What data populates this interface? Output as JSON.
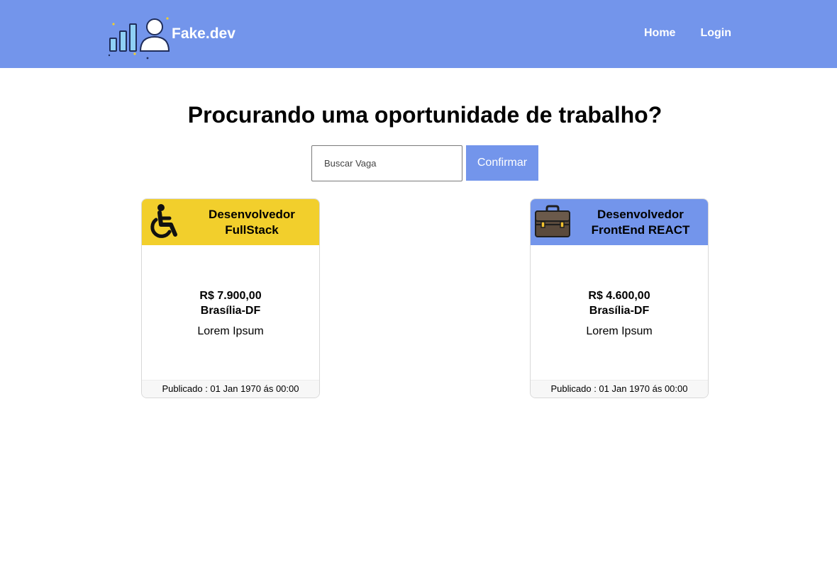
{
  "brand": {
    "name": "Fake.dev",
    "logo": "chart-person-logo"
  },
  "nav": {
    "home": "Home",
    "login": "Login"
  },
  "headline": "Procurando uma oportunidade de trabalho?",
  "search": {
    "placeholder": "Buscar Vaga",
    "value": "",
    "button": "Confirmar"
  },
  "colors": {
    "primary": "#7395eb",
    "accessible_card": "#f2cf2c"
  },
  "jobs": [
    {
      "icon": "wheelchair-icon",
      "title_line1": "Desenvolvedor",
      "title_line2": "FullStack",
      "salary": "R$ 7.900,00",
      "location": "Brasília-DF",
      "description": "Lorem Ipsum",
      "published": "Publicado : 01 Jan 1970 ás 00:00"
    },
    {
      "icon": "briefcase-icon",
      "title_line1": "Desenvolvedor",
      "title_line2": "FrontEnd REACT",
      "salary": "R$ 4.600,00",
      "location": "Brasília-DF",
      "description": "Lorem Ipsum",
      "published": "Publicado : 01 Jan 1970 ás 00:00"
    }
  ]
}
